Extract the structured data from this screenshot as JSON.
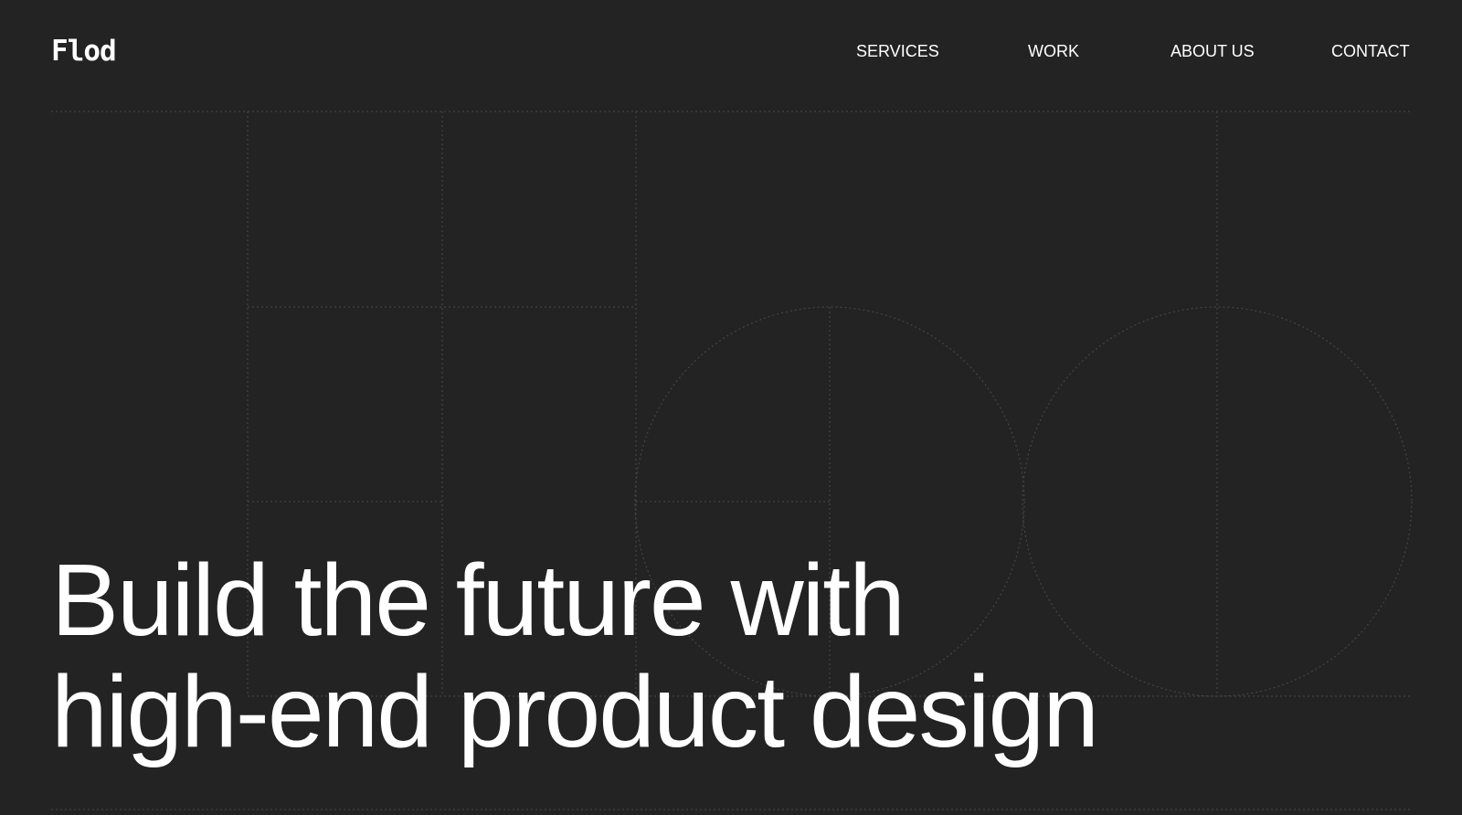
{
  "brand": {
    "name": "Flod"
  },
  "nav": {
    "items": [
      {
        "label": "SERVICES"
      },
      {
        "label": "WORK"
      },
      {
        "label": "ABOUT US"
      },
      {
        "label": "CONTACT"
      }
    ]
  },
  "hero": {
    "line1": "Build the future with",
    "line2": "high-end product design"
  },
  "colors": {
    "background": "#232323",
    "text": "#ffffff",
    "grid_lines": "#4a4a4a"
  }
}
